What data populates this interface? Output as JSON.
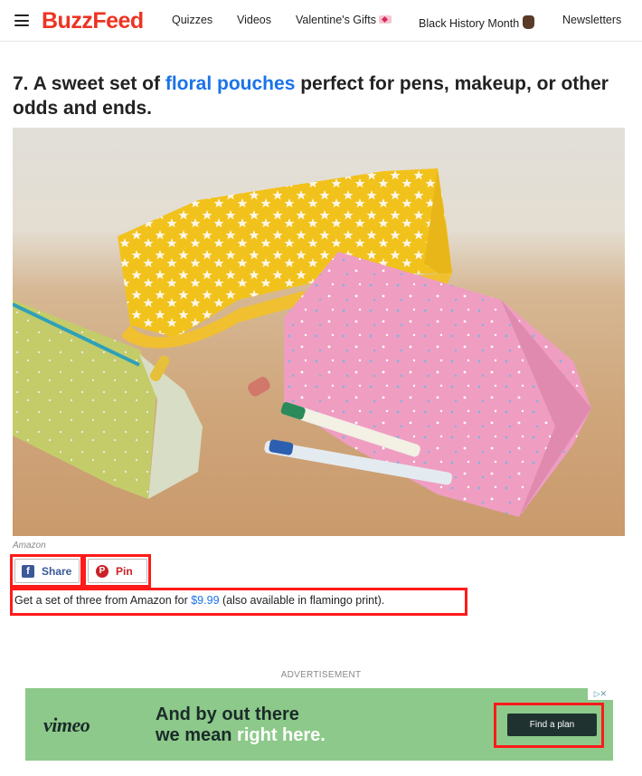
{
  "header": {
    "logo": "BuzzFeed",
    "nav": {
      "quizzes": "Quizzes",
      "videos": "Videos",
      "valentines": "Valentine's Gifts",
      "black_history_month": "Black History Month",
      "newsletters": "Newsletters"
    },
    "icons": {
      "menu": "hamburger-menu-icon",
      "valentines": "love-letter-icon",
      "black_history_month": "raised-fist-icon"
    }
  },
  "article": {
    "title_prefix": "7. A sweet set of ",
    "title_link": "floral pouches",
    "title_suffix": " perfect for pens, makeup, or other odds and ends.",
    "image_credit": "Amazon",
    "share_label": "Share",
    "pin_label": "Pin",
    "desc_prefix": "Get a set of three from Amazon for ",
    "desc_price": "$9.99",
    "desc_suffix": " (also available in flamingo print).",
    "colors": {
      "link": "#1a73e8",
      "logo": "#ee3322",
      "highlight": "#ff1a1a"
    }
  },
  "ad": {
    "label": "ADVERTISEMENT",
    "brand": "vimeo",
    "headline_line1": "And by out there",
    "headline_line2_prefix": "we mean ",
    "headline_line2_highlight": "right here.",
    "cta": "Find a plan",
    "adchoices": "▷✕",
    "colors": {
      "background": "#8dc98a",
      "button": "#203230"
    }
  }
}
